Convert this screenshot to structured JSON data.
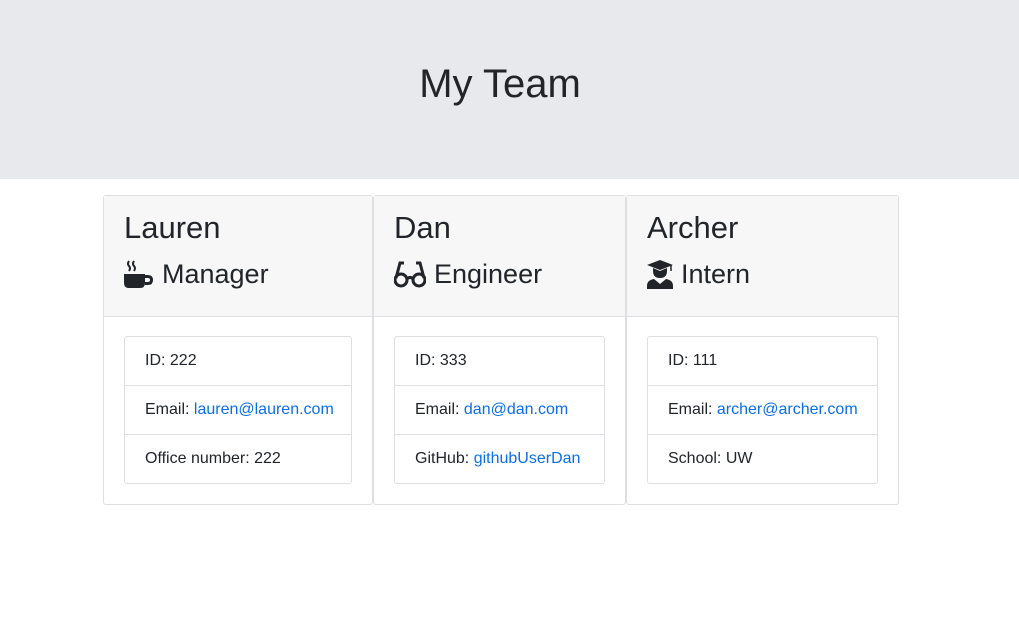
{
  "page": {
    "title": "My Team"
  },
  "employees": [
    {
      "name": "Lauren",
      "role": "Manager",
      "icon": "coffee-mug-icon",
      "id_label": "ID: 222",
      "email_prefix": "Email: ",
      "email": "lauren@lauren.com",
      "extra_prefix": "Office number: 222",
      "extra_value": ""
    },
    {
      "name": "Dan",
      "role": "Engineer",
      "icon": "glasses-icon",
      "id_label": "ID: 333",
      "email_prefix": "Email: ",
      "email": "dan@dan.com",
      "extra_prefix": "GitHub: ",
      "extra_value": "githubUserDan"
    },
    {
      "name": "Archer",
      "role": "Intern",
      "icon": "graduate-icon",
      "id_label": "ID: 111",
      "email_prefix": "Email: ",
      "email": "archer@archer.com",
      "extra_prefix": "School: UW",
      "extra_value": ""
    }
  ],
  "colors": {
    "header_bg": "#e7e9ed",
    "card_header_bg": "#f7f7f7",
    "link": "#0a6fe6",
    "text": "#212529"
  }
}
